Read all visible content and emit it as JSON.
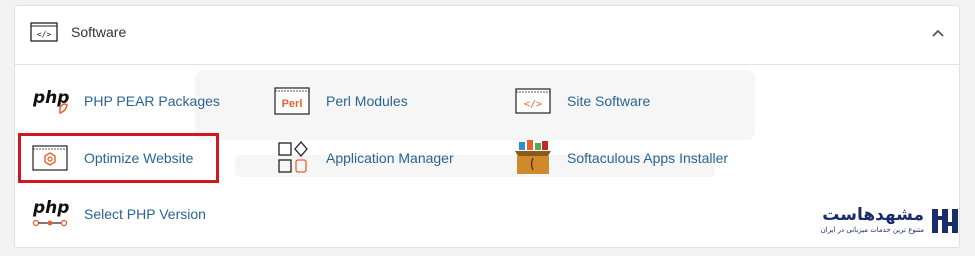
{
  "section": {
    "title": "Software",
    "header_icon": "code-brackets-icon",
    "collapse_icon": "chevron-up-icon"
  },
  "items": [
    {
      "label": "PHP PEAR Packages",
      "icon": "php-pear-icon",
      "icon_text": "php"
    },
    {
      "label": "Perl Modules",
      "icon": "perl-icon",
      "icon_text": "Perl"
    },
    {
      "label": "Site Software",
      "icon": "code-brackets-icon"
    },
    {
      "label": "Optimize Website",
      "icon": "gear-icon"
    },
    {
      "label": "Application Manager",
      "icon": "app-grid-icon"
    },
    {
      "label": "Softaculous Apps Installer",
      "icon": "softaculous-box-icon"
    },
    {
      "label": "Select PHP Version",
      "icon": "php-version-icon",
      "icon_text": "php"
    }
  ],
  "highlight_color": "#d0181e",
  "accent_color": "#2a6496",
  "watermark": {
    "name": "مشهدهاست",
    "tagline": "متنوع ترین خدمات میزبانی در ایران"
  }
}
